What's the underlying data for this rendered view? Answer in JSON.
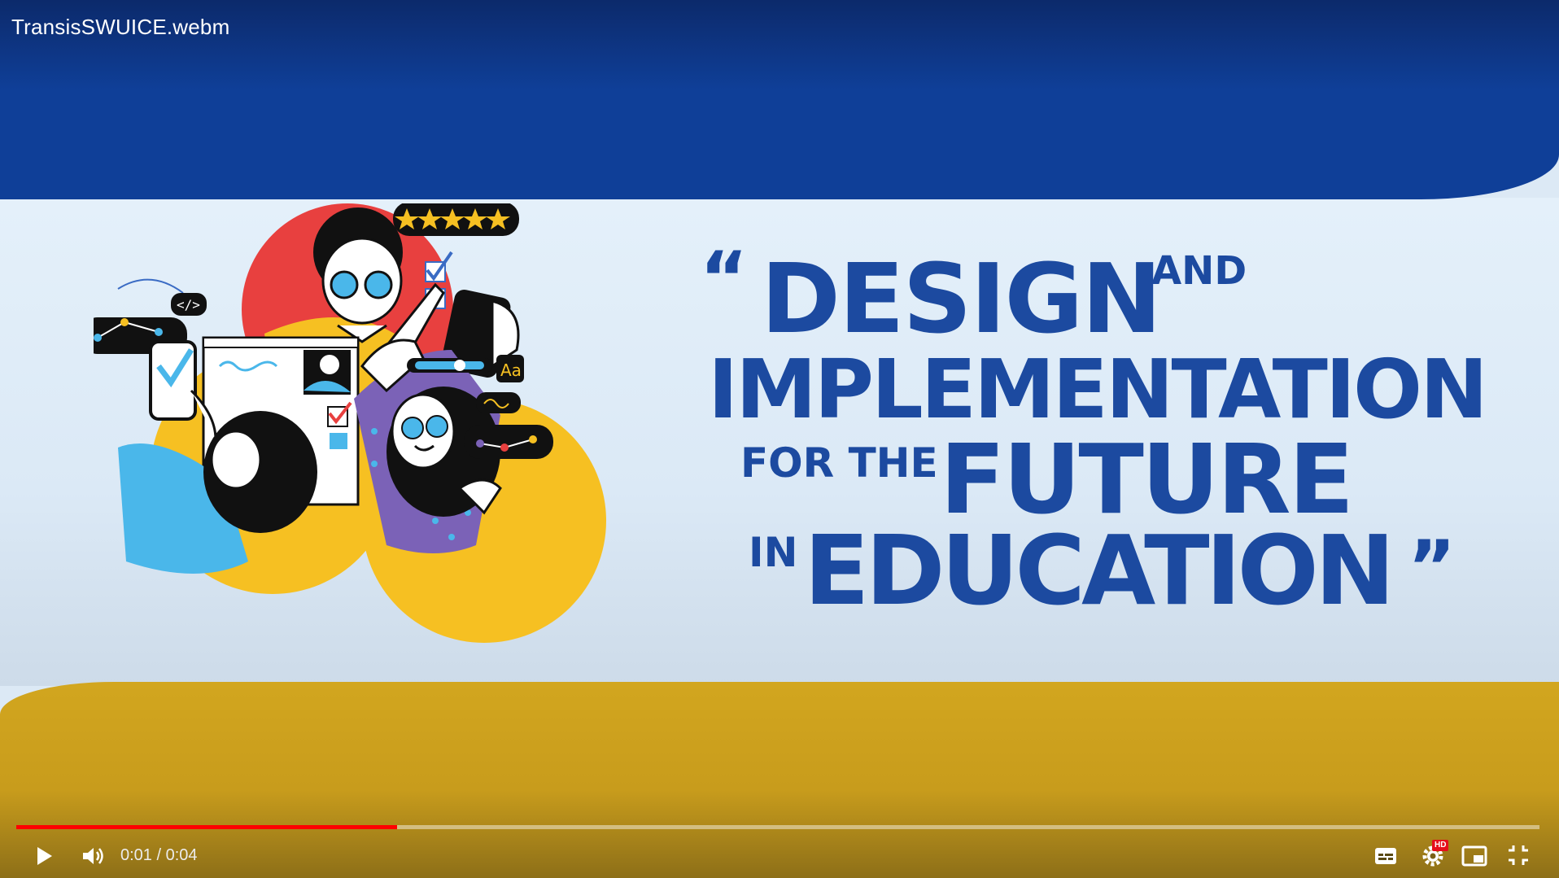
{
  "player": {
    "title": "TransisSWUICE.webm",
    "time_display": "0:01 / 0:04",
    "progress_fraction": 0.25,
    "quality_badge": "HD",
    "progress_color": "#ff0000"
  },
  "slide": {
    "quote_open": "“",
    "word_design": "DESIGN",
    "word_and": "AND",
    "word_implementation": "IMPLEMENTATION",
    "word_for_the": "FOR THE",
    "word_future": "FUTURE",
    "word_in": "IN",
    "word_education": "EDUCATION",
    "quote_close": "”",
    "colors": {
      "top_band": "#0f3f98",
      "bottom_band": "#d2a61f",
      "headline": "#1c4aa0",
      "background": "#dce9f5"
    }
  },
  "icons": [
    "play-icon",
    "volume-icon",
    "subtitles-icon",
    "settings-icon",
    "miniplayer-icon",
    "exit-fullscreen-icon"
  ]
}
